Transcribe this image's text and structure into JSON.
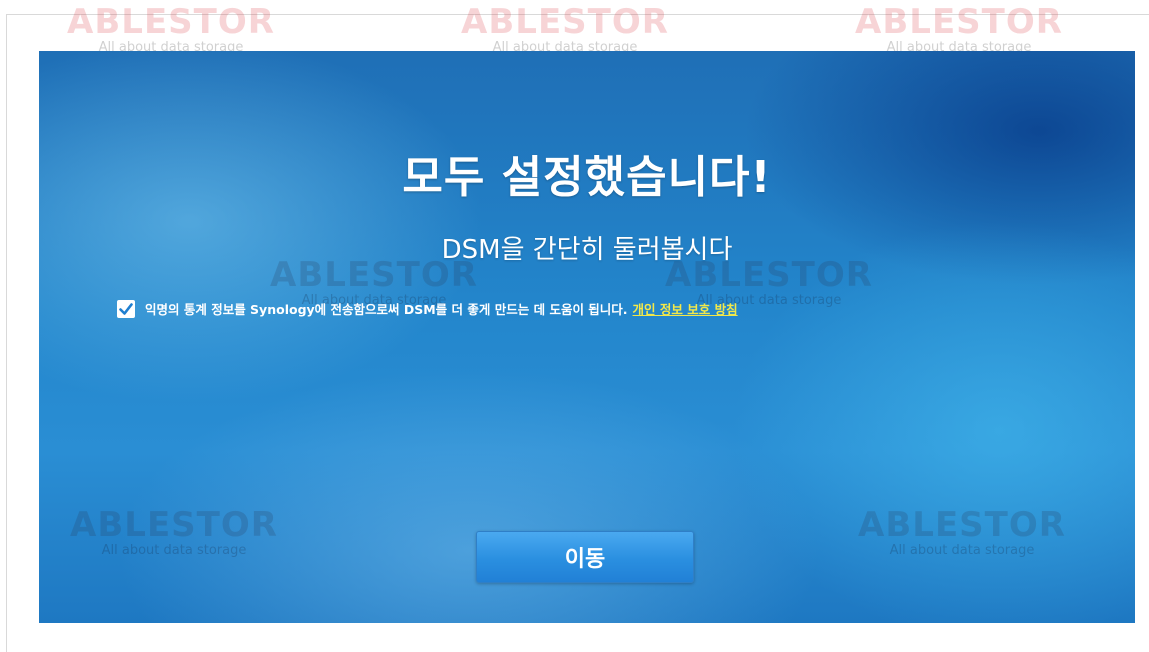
{
  "title": "모두 설정했습니다!",
  "subtitle": "DSM을 간단히 둘러봅시다",
  "consent": {
    "checked": true,
    "text": "익명의 통계 정보를 Synology에 전송함으로써 DSM를 더 좋게 만드는 데 도움이 됩니다.",
    "privacy_link": "개인 정보 보호 방침"
  },
  "go_button": "이동",
  "watermark": {
    "logo": "ABLESTOR",
    "tagline": "All about data storage"
  },
  "colors": {
    "panel_blue": "#2386cc",
    "button_blue": "#2a8fe0",
    "link_yellow": "#f2e84a",
    "watermark_red": "#dc3c46"
  }
}
